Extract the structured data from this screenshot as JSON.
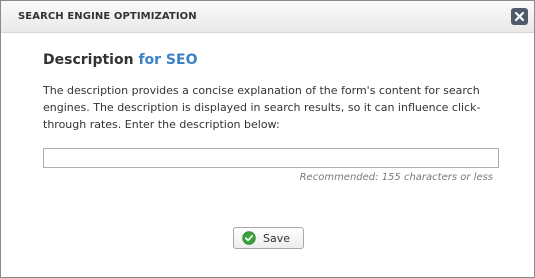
{
  "dialog": {
    "title": "SEARCH ENGINE OPTIMIZATION",
    "close_icon": "close-icon"
  },
  "section": {
    "heading_main": "Description",
    "heading_accent": "for SEO",
    "description": "The description provides a concise explanation of the form's content for search engines. The description is displayed in search results, so it can influence click-through rates. Enter the description below:"
  },
  "description_field": {
    "value": "",
    "placeholder": "",
    "hint": "Recommended: 155 characters or less"
  },
  "save_button": {
    "label": "Save",
    "icon": "check-circle-icon"
  },
  "colors": {
    "accent": "#3a82c4",
    "close_button": "#4e5b68",
    "check_icon": "#3aa33a"
  }
}
